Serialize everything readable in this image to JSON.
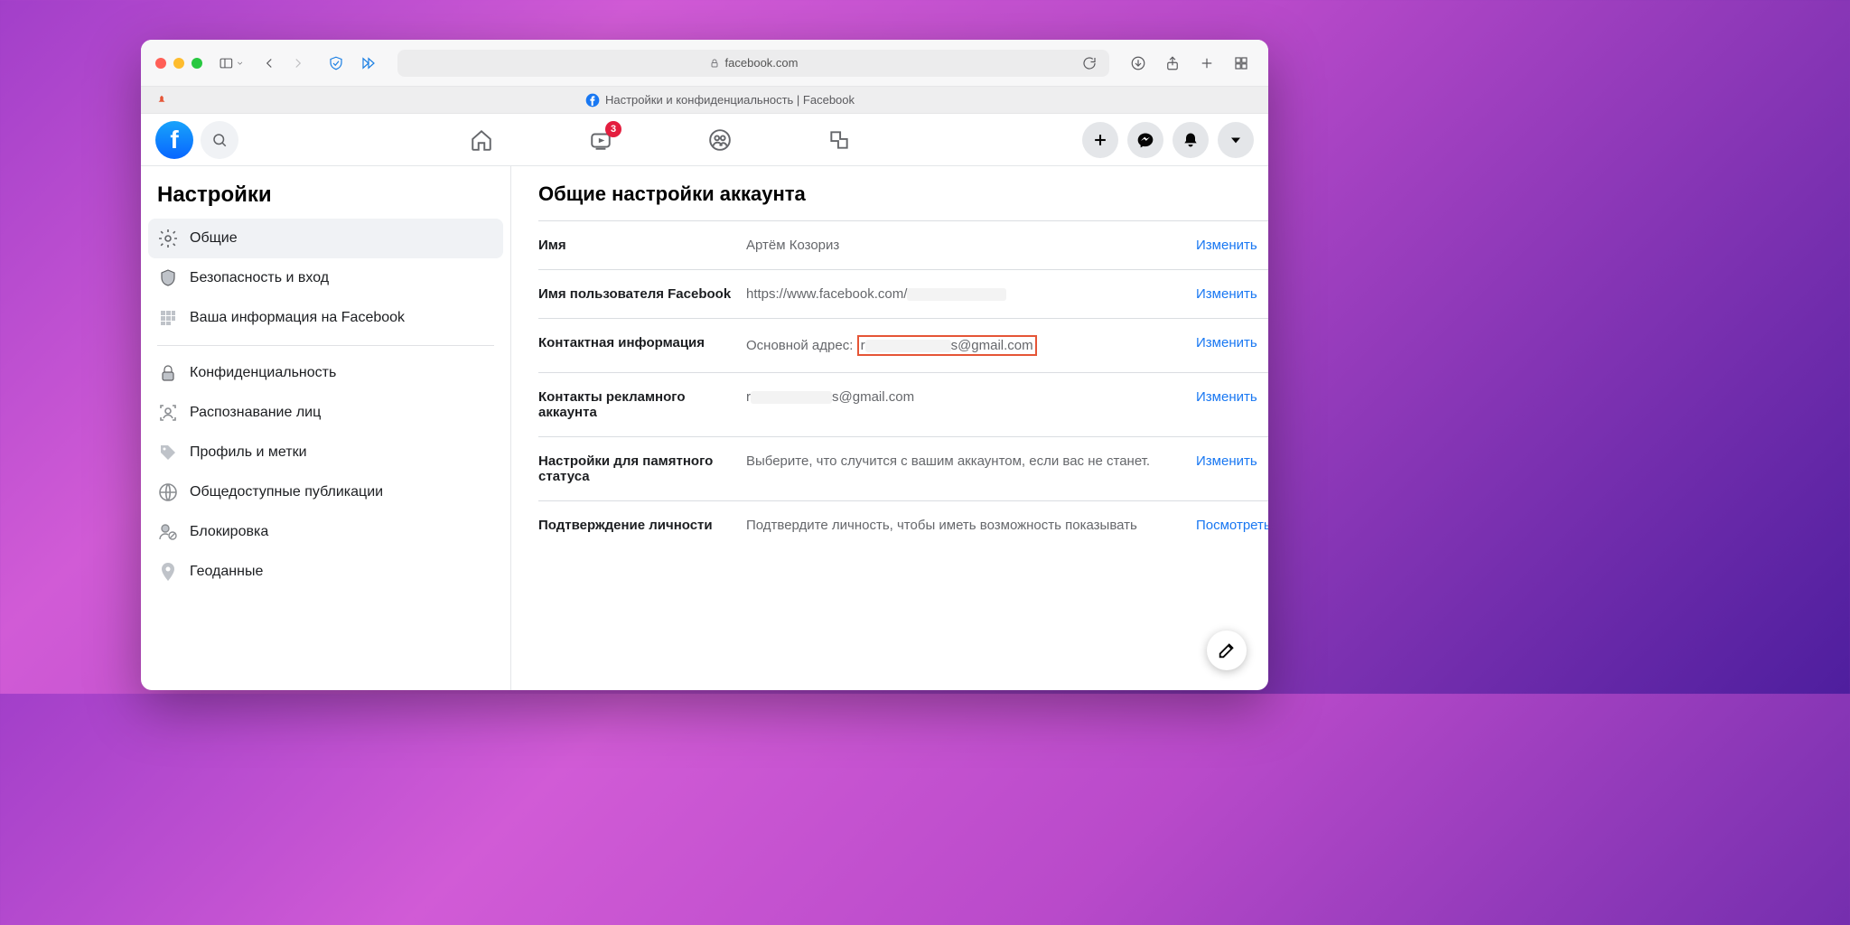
{
  "browser": {
    "url_display": "facebook.com",
    "tab_title": "Настройки и конфиденциальность | Facebook"
  },
  "fb_top": {
    "badge_video": "3"
  },
  "sidebar": {
    "title": "Настройки",
    "items": [
      {
        "label": "Общие"
      },
      {
        "label": "Безопасность и вход"
      },
      {
        "label": "Ваша информация на Facebook"
      },
      {
        "label": "Конфиденциальность"
      },
      {
        "label": "Распознавание лиц"
      },
      {
        "label": "Профиль и метки"
      },
      {
        "label": "Общедоступные публикации"
      },
      {
        "label": "Блокировка"
      },
      {
        "label": "Геоданные"
      }
    ]
  },
  "main": {
    "title": "Общие настройки аккаунта",
    "rows": {
      "name": {
        "label": "Имя",
        "value": "Артём Козориз",
        "action": "Изменить"
      },
      "username": {
        "label": "Имя пользователя Facebook",
        "value": "https://www.facebook.com/",
        "action": "Изменить"
      },
      "contact": {
        "label": "Контактная информация",
        "prefix": "Основной адрес:",
        "email_l": "r",
        "email_r": "s@gmail.com",
        "action": "Изменить"
      },
      "adcontact": {
        "label": "Контакты рекламного аккаунта",
        "email_l": "r",
        "email_r": "s@gmail.com",
        "action": "Изменить"
      },
      "memorial": {
        "label": "Настройки для памятного статуса",
        "value": "Выберите, что случится с вашим аккаунтом, если вас не станет.",
        "action": "Изменить"
      },
      "identity": {
        "label": "Подтверждение личности",
        "value": "Подтвердите личность, чтобы иметь возможность показывать",
        "action": "Посмотреть"
      }
    }
  }
}
